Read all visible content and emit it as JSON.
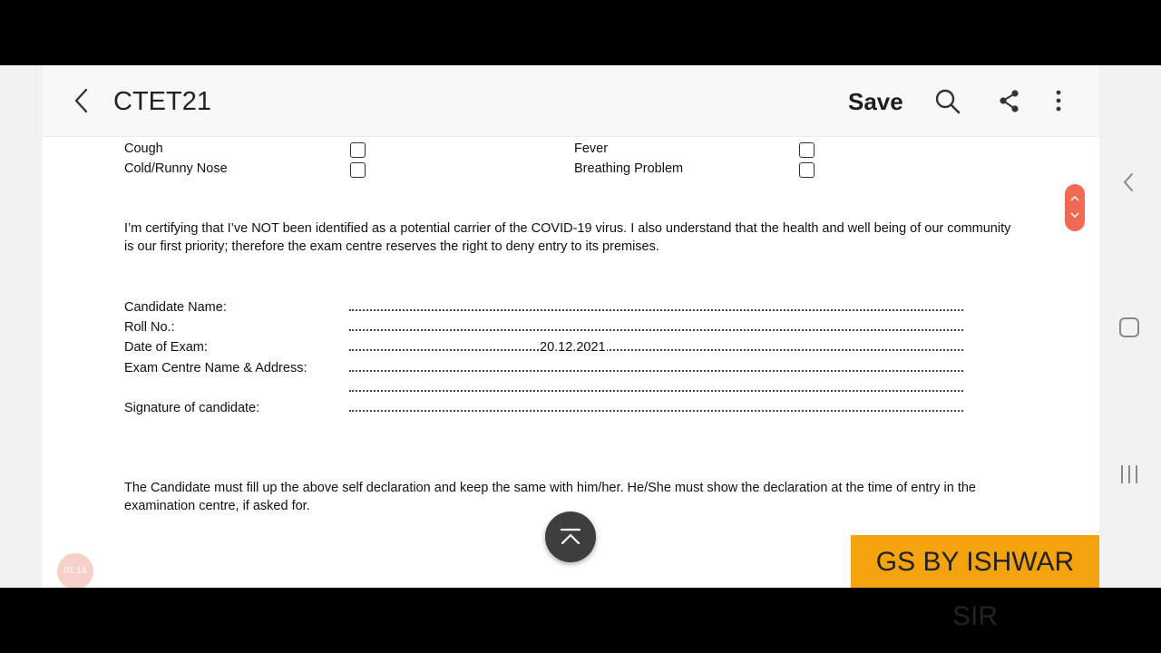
{
  "app": {
    "title": "CTET21",
    "save_label": "Save",
    "icons": [
      "back-arrow-icon",
      "search-icon",
      "share-icon",
      "more-vert-icon"
    ]
  },
  "symptoms": [
    {
      "label": "Cough",
      "checked": false
    },
    {
      "label": "Cold/Runny Nose",
      "checked": false
    },
    {
      "label": "Fever",
      "checked": false
    },
    {
      "label": "Breathing Problem",
      "checked": false
    }
  ],
  "declaration": {
    "certify_text": "I’m certifying that I’ve NOT been identified as a potential carrier of the COVID-19 virus. I also understand that the health and well being of our community is our first priority; therefore the exam centre reserves the right to deny entry to its premises.",
    "fields": [
      {
        "label": "Candidate Name:",
        "value": ""
      },
      {
        "label": "Roll No.:",
        "value": ""
      },
      {
        "label": "Date of Exam:",
        "value": "20.12.2021"
      },
      {
        "label": "Exam Centre Name & Address:",
        "value": ""
      },
      {
        "label": "Signature of candidate:",
        "value": ""
      }
    ],
    "note": "The Candidate must fill up the above self declaration and keep the same with him/her. He/She must show the declaration at the time of entry in the examination centre, if asked for."
  },
  "timer": "01:14",
  "watermark": "GS BY ISHWAR SIR",
  "colors": {
    "accent": "#ef6a54",
    "fab": "#3d3f3f",
    "watermark_bg": "#f4a30d"
  }
}
